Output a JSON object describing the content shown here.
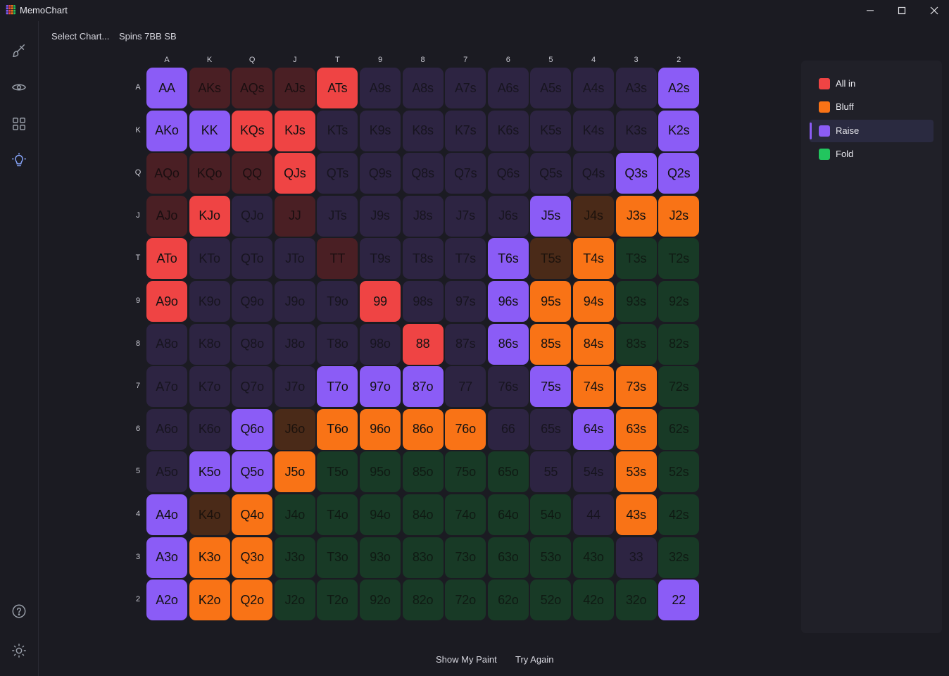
{
  "window": {
    "title": "MemoChart"
  },
  "topbar": {
    "select_chart": "Select Chart...",
    "chart_name": "Spins 7BB SB"
  },
  "columns": [
    "A",
    "K",
    "Q",
    "J",
    "T",
    "9",
    "8",
    "7",
    "6",
    "5",
    "4",
    "3",
    "2"
  ],
  "rows": [
    "A",
    "K",
    "Q",
    "J",
    "T",
    "9",
    "8",
    "7",
    "6",
    "5",
    "4",
    "3",
    "2"
  ],
  "legend": [
    {
      "label": "All in",
      "color": "#ef4444"
    },
    {
      "label": "Bluff",
      "color": "#f97316"
    },
    {
      "label": "Raise",
      "color": "#8b5cf6",
      "selected": true
    },
    {
      "label": "Fold",
      "color": "#22c55e"
    }
  ],
  "colors": {
    "raise": "#8b5cf6",
    "all_in": "#ef4444",
    "bluff": "#f97316",
    "fold": "#22c55e",
    "background": "#1b1b22"
  },
  "grid": [
    [
      "raise-on",
      "allin-off",
      "allin-off",
      "allin-off",
      "allin-on",
      "raise-off",
      "raise-off",
      "raise-off",
      "raise-off",
      "raise-off",
      "raise-off",
      "raise-off",
      "raise-on"
    ],
    [
      "raise-on",
      "raise-on",
      "allin-on",
      "allin-on",
      "raise-off",
      "raise-off",
      "raise-off",
      "raise-off",
      "raise-off",
      "raise-off",
      "raise-off",
      "raise-off",
      "raise-on"
    ],
    [
      "allin-off",
      "allin-off",
      "allin-off",
      "allin-on",
      "raise-off",
      "raise-off",
      "raise-off",
      "raise-off",
      "raise-off",
      "raise-off",
      "raise-off",
      "raise-on",
      "raise-on"
    ],
    [
      "allin-off",
      "allin-on",
      "raise-off",
      "allin-off",
      "raise-off",
      "raise-off",
      "raise-off",
      "raise-off",
      "raise-off",
      "raise-on",
      "bluff-off",
      "bluff-on",
      "bluff-on"
    ],
    [
      "allin-on",
      "raise-off",
      "raise-off",
      "raise-off",
      "allin-off",
      "raise-off",
      "raise-off",
      "raise-off",
      "raise-on",
      "bluff-off",
      "bluff-on",
      "fold-off",
      "fold-off"
    ],
    [
      "allin-on",
      "raise-off",
      "raise-off",
      "raise-off",
      "raise-off",
      "allin-on",
      "raise-off",
      "raise-off",
      "raise-on",
      "bluff-on",
      "bluff-on",
      "fold-off",
      "fold-off"
    ],
    [
      "raise-off",
      "raise-off",
      "raise-off",
      "raise-off",
      "raise-off",
      "raise-off",
      "allin-on",
      "raise-off",
      "raise-on",
      "bluff-on",
      "bluff-on",
      "fold-off",
      "fold-off"
    ],
    [
      "raise-off",
      "raise-off",
      "raise-off",
      "raise-off",
      "raise-on",
      "raise-on",
      "raise-on",
      "raise-off",
      "raise-off",
      "raise-on",
      "bluff-on",
      "bluff-on",
      "fold-off"
    ],
    [
      "raise-off",
      "raise-off",
      "raise-on",
      "bluff-off",
      "bluff-on",
      "bluff-on",
      "bluff-on",
      "bluff-on",
      "raise-off",
      "raise-off",
      "raise-on",
      "bluff-on",
      "fold-off"
    ],
    [
      "raise-off",
      "raise-on",
      "raise-on",
      "bluff-on",
      "fold-off",
      "fold-off",
      "fold-off",
      "fold-off",
      "fold-off",
      "raise-off",
      "raise-off",
      "bluff-on",
      "fold-off"
    ],
    [
      "raise-on",
      "bluff-off",
      "bluff-on",
      "fold-off",
      "fold-off",
      "fold-off",
      "fold-off",
      "fold-off",
      "fold-off",
      "fold-off",
      "raise-off",
      "bluff-on",
      "fold-off"
    ],
    [
      "raise-on",
      "bluff-on",
      "bluff-on",
      "fold-off",
      "fold-off",
      "fold-off",
      "fold-off",
      "fold-off",
      "fold-off",
      "fold-off",
      "fold-off",
      "raise-off",
      "fold-off"
    ],
    [
      "raise-on",
      "bluff-on",
      "bluff-on",
      "fold-off",
      "fold-off",
      "fold-off",
      "fold-off",
      "fold-off",
      "fold-off",
      "fold-off",
      "fold-off",
      "fold-off",
      "raise-on"
    ]
  ],
  "actions": {
    "show_paint": "Show My Paint",
    "try_again": "Try Again"
  },
  "sidebar_icons": [
    "brush-icon",
    "eye-icon",
    "grid-icon",
    "lightbulb-icon",
    "help-icon",
    "sun-icon"
  ]
}
